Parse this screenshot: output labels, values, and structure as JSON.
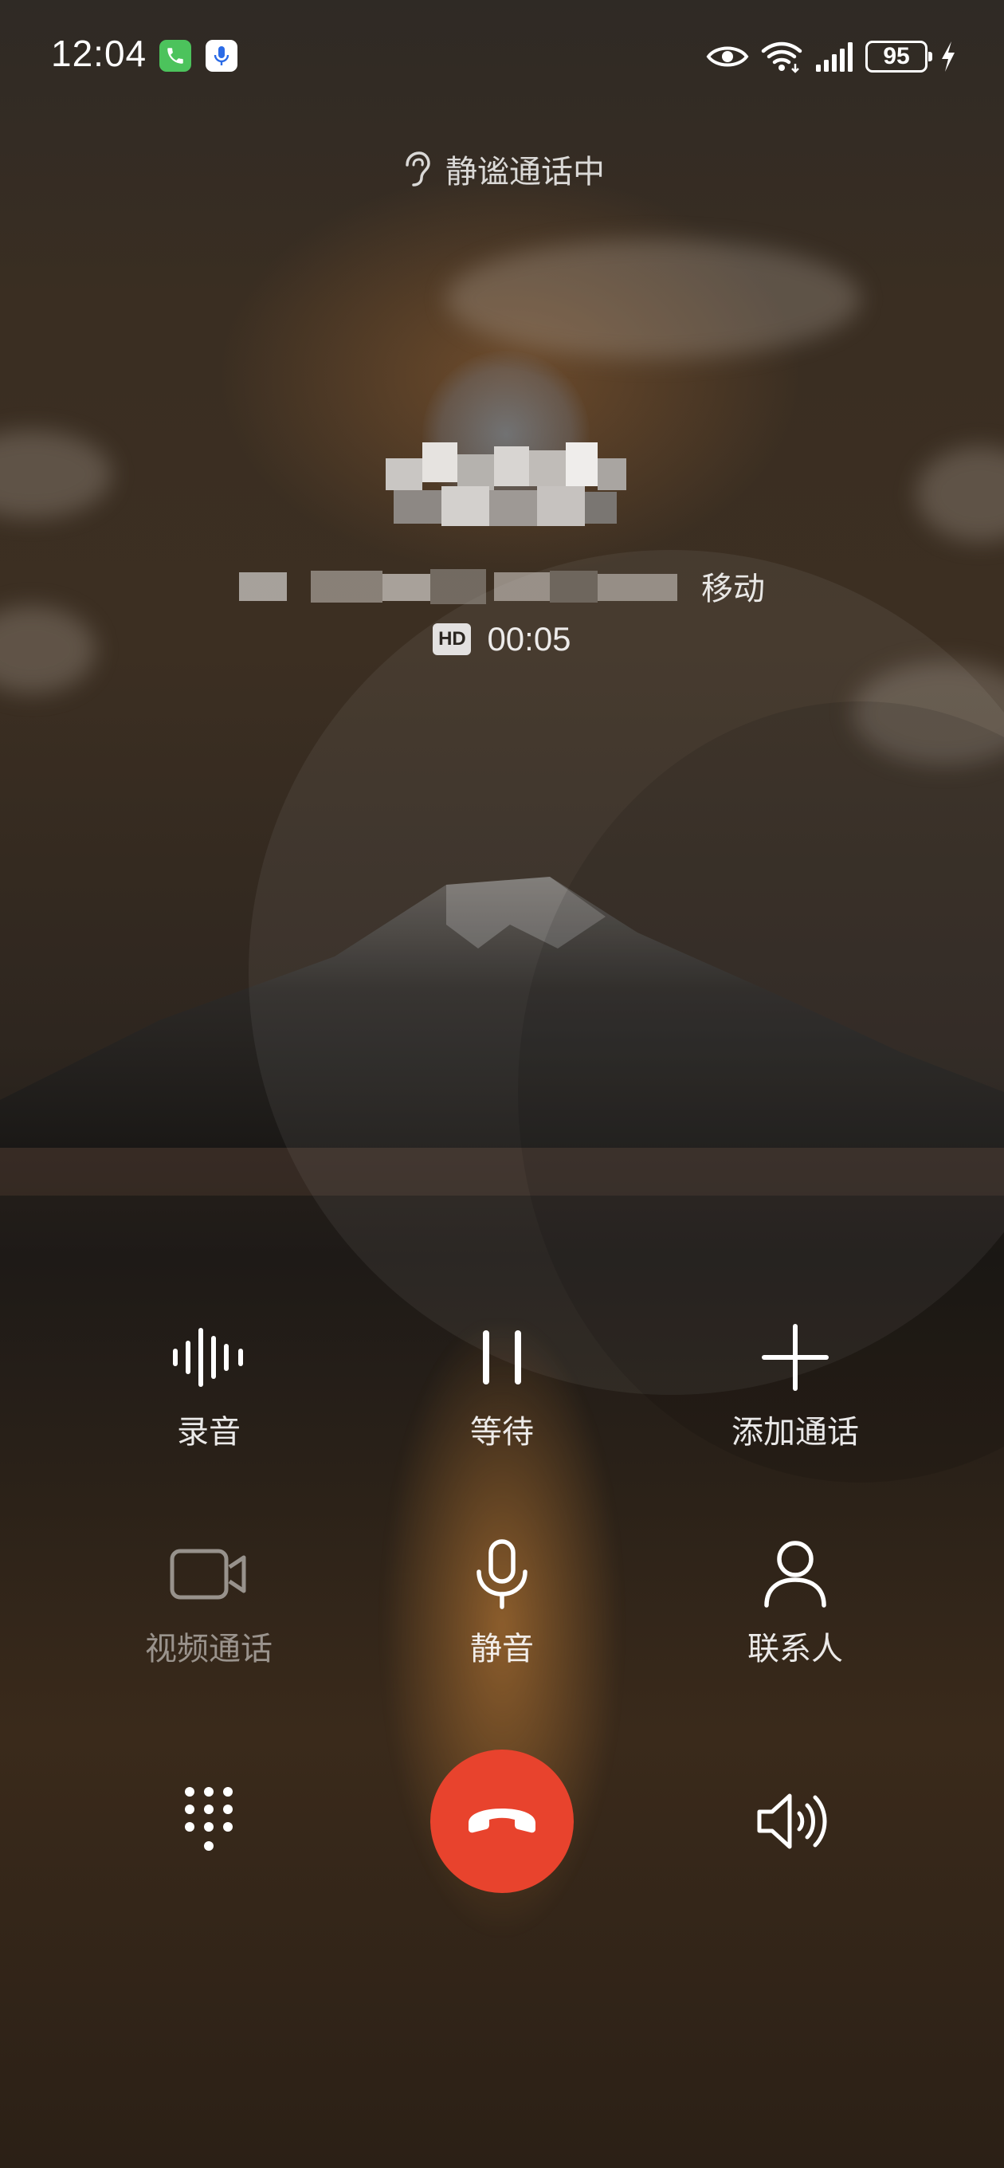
{
  "status_bar": {
    "time": "12:04",
    "battery": "95",
    "icons": [
      "phone-call-icon",
      "microphone-icon",
      "eye-icon",
      "wifi-icon",
      "signal-icon",
      "battery-icon",
      "charging-icon"
    ]
  },
  "call": {
    "mode_label": "静谧通话中",
    "carrier": "移动",
    "hd_badge": "HD",
    "duration": "00:05"
  },
  "controls": {
    "record": "录音",
    "hold": "等待",
    "add_call": "添加通话",
    "video_call": "视频通话",
    "mute": "静音",
    "contacts": "联系人"
  },
  "colors": {
    "end_call": "#e8432d",
    "status_call_icon": "#4cc35c",
    "status_mic_icon": "#2b6be6"
  }
}
